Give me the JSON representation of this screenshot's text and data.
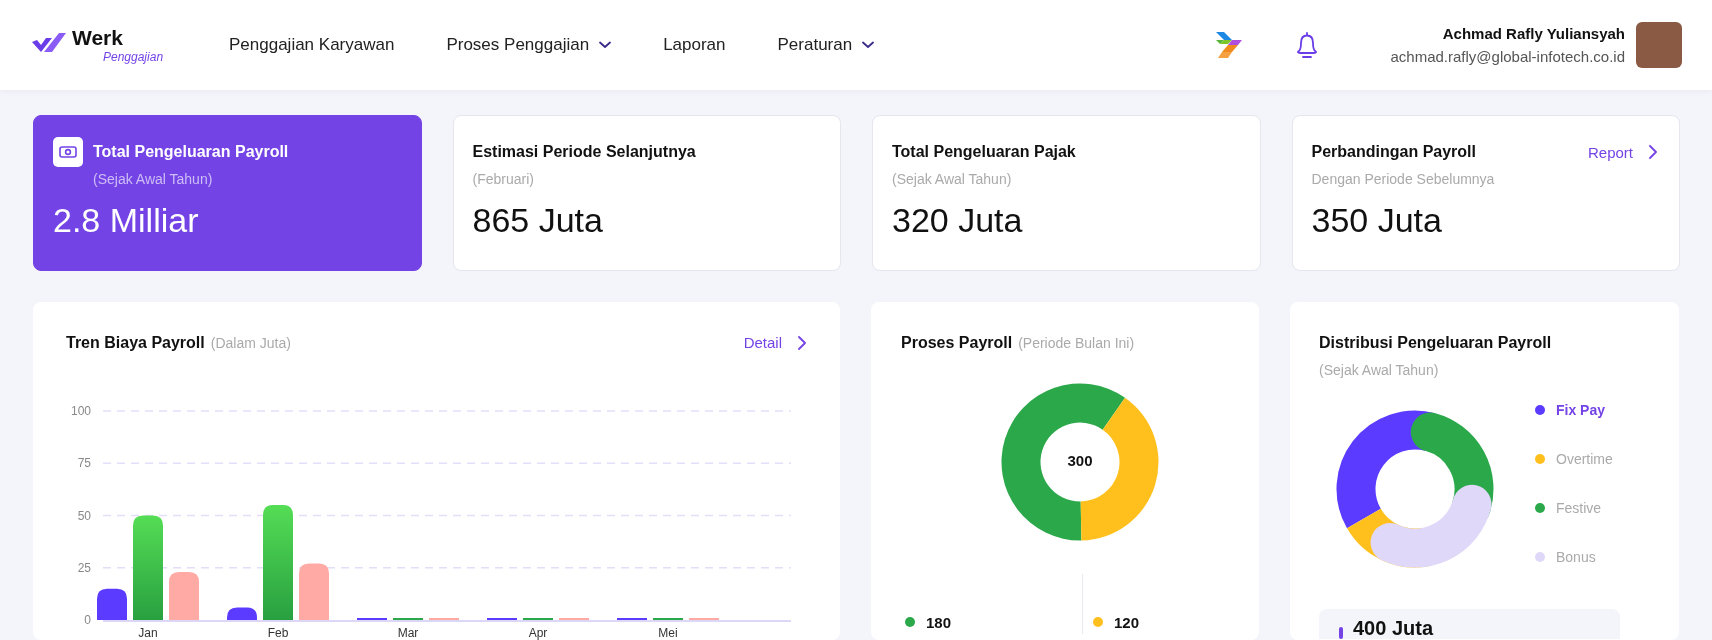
{
  "header": {
    "logo": {
      "name": "Werk",
      "tagline": "Penggajian"
    },
    "nav": [
      {
        "label": "Penggajian Karyawan",
        "has_dropdown": false
      },
      {
        "label": "Proses Penggajian",
        "has_dropdown": true
      },
      {
        "label": "Laporan",
        "has_dropdown": false
      },
      {
        "label": "Peraturan",
        "has_dropdown": true
      }
    ],
    "user": {
      "name": "Achmad Rafly Yuliansyah",
      "email": "achmad.rafly@global-infotech.co.id"
    }
  },
  "summary_cards": [
    {
      "title": "Total Pengeluaran Payroll",
      "subtitle": "(Sejak Awal Tahun)",
      "value": "2.8 Milliar",
      "highlighted": true
    },
    {
      "title": "Estimasi Periode Selanjutnya",
      "subtitle": "(Februari)",
      "value": "865 Juta",
      "highlighted": false
    },
    {
      "title": "Total Pengeluaran Pajak",
      "subtitle": "(Sejak Awal Tahun)",
      "value": "320 Juta",
      "highlighted": false
    },
    {
      "title": "Perbandingan Payroll",
      "subtitle": "Dengan Periode Sebelumnya",
      "value": "350 Juta",
      "highlighted": false,
      "link": "Report"
    }
  ],
  "payroll_trend": {
    "title": "Tren Biaya Payroll",
    "subtitle": "(Dalam Juta)",
    "link": "Detail",
    "chart_data": {
      "type": "bar",
      "grid": true,
      "categories": [
        "Jan",
        "Feb",
        "Mar",
        "Apr",
        "Mei"
      ],
      "ylim": [
        0,
        100
      ],
      "yticks": [
        0,
        25,
        50,
        75,
        100
      ],
      "series": [
        {
          "color": "#5b3bff",
          "values": [
            15,
            6,
            0,
            0,
            0
          ]
        },
        {
          "color": "#2aa84a",
          "values": [
            50,
            55,
            0,
            0,
            0
          ]
        },
        {
          "color": "#ffaaa5",
          "values": [
            23,
            27,
            0,
            0,
            0
          ]
        }
      ]
    }
  },
  "payroll_process": {
    "title": "Proses Payroll",
    "subtitle": "(Periode Bulan Ini)",
    "total": "300",
    "chart_data": {
      "type": "donut",
      "values": [
        60,
        40
      ]
    },
    "legend": [
      {
        "value": "180",
        "color": "#2aa84a"
      },
      {
        "value": "120",
        "color": "#ffc01e"
      }
    ]
  },
  "payroll_distribution": {
    "title": "Distribusi Pengeluaran Payroll",
    "subtitle": "(Sejak Awal Tahun)",
    "legend": [
      {
        "label": "Fix Pay",
        "color": "#5b3bff",
        "selected": true
      },
      {
        "label": "Overtime",
        "color": "#ffc01e",
        "selected": false
      },
      {
        "label": "Festive",
        "color": "#2aa84a",
        "selected": false
      },
      {
        "label": "Bonus",
        "color": "#e0d8f8",
        "selected": false
      }
    ],
    "highlight": {
      "value": "400 Juta"
    }
  }
}
